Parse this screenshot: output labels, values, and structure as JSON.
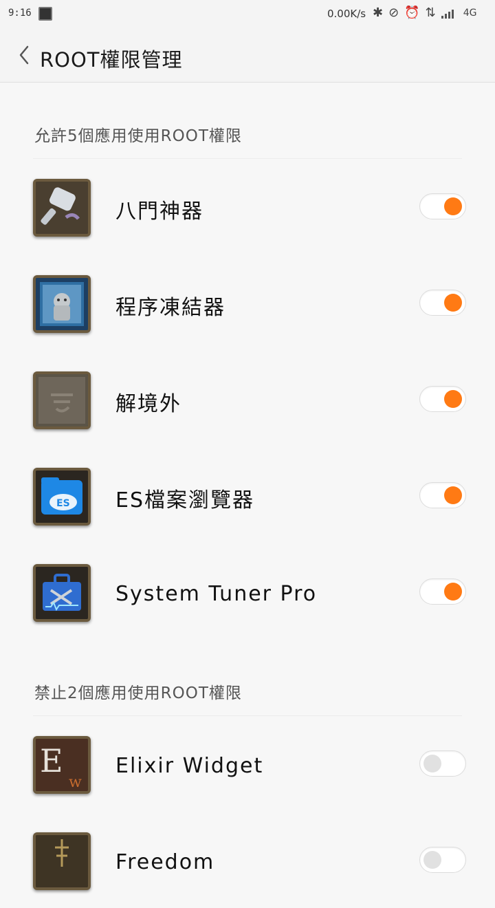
{
  "status_bar": {
    "time": "9:16",
    "net_speed": "0.00K/s",
    "network_type": "4G",
    "icons": [
      "notification-icon",
      "bluetooth-icon",
      "vibrate-off-icon",
      "alarm-icon",
      "data-arrows-icon",
      "signal-icon"
    ]
  },
  "header": {
    "title": "ROOT權限管理",
    "back_icon": "chevron-left-icon"
  },
  "sections": {
    "allowed": {
      "label": "允許5個應用使用ROOT權限",
      "apps": [
        {
          "name": "八門神器",
          "enabled": true
        },
        {
          "name": "程序凍結器",
          "enabled": true
        },
        {
          "name": "解境外",
          "enabled": true
        },
        {
          "name": "ES檔案瀏覽器",
          "enabled": true
        },
        {
          "name": "System Tuner Pro",
          "enabled": true
        }
      ]
    },
    "denied": {
      "label": "禁止2個應用使用ROOT權限",
      "apps": [
        {
          "name": "Elixir Widget",
          "enabled": false
        },
        {
          "name": "Freedom",
          "enabled": false
        }
      ]
    }
  },
  "colors": {
    "toggle_on": "#ff7a14",
    "toggle_off": "#e1e1e1",
    "progress": "#5ed33a"
  }
}
